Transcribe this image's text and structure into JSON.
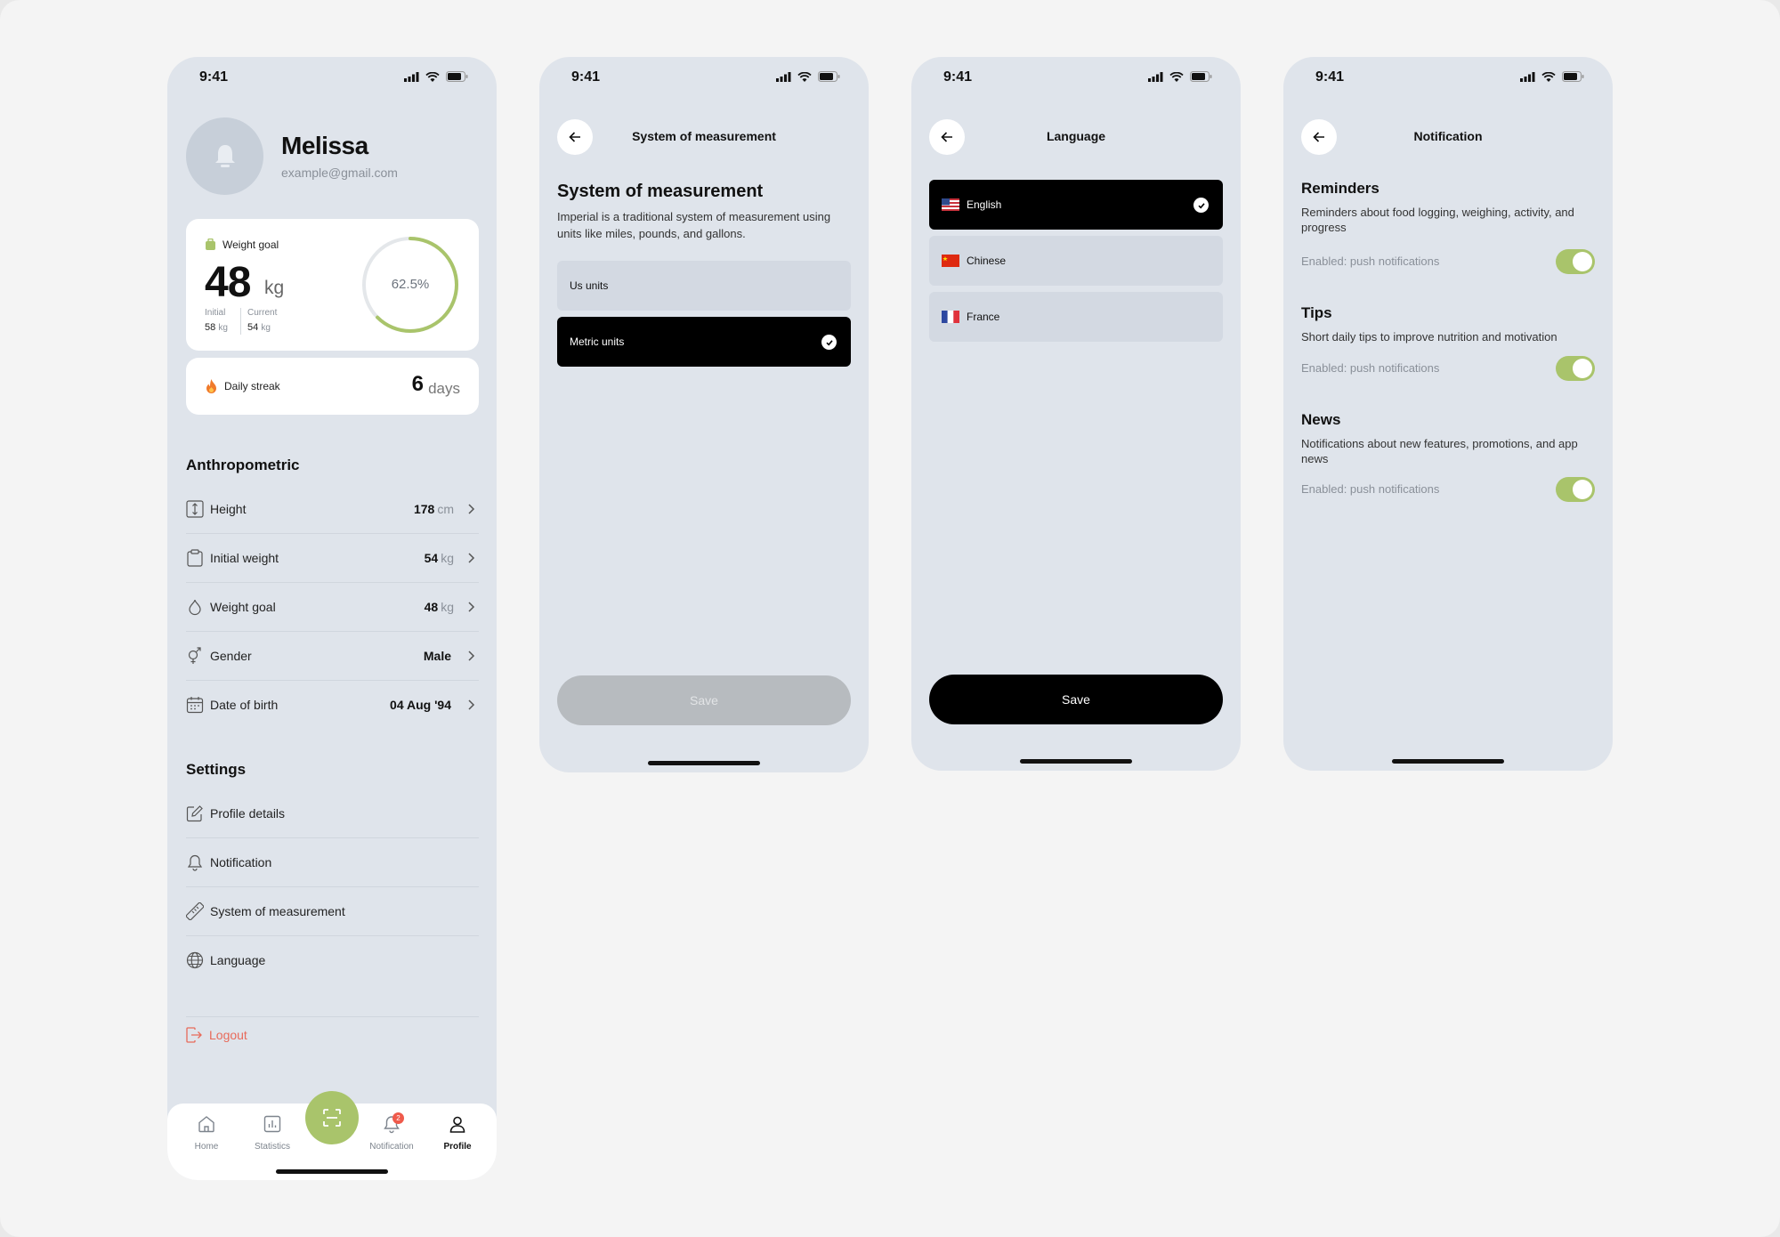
{
  "status_time": "9:41",
  "colors": {
    "accent_green": "#a9c46b",
    "danger": "#e86a5a",
    "phone_bg": "#dfe4eb"
  },
  "profile": {
    "name": "Melissa",
    "email": "example@gmail.com",
    "weight_goal": {
      "label": "Weight goal",
      "value": "48",
      "unit": "kg",
      "initial_label": "Initial",
      "initial_value": "58",
      "current_label": "Current",
      "current_value": "54",
      "small_unit": "kg",
      "progress_text": "62.5%",
      "progress_fraction": 0.625
    },
    "streak": {
      "label": "Daily streak",
      "value": "6",
      "unit": "days"
    },
    "anthropometric_title": "Anthropometric",
    "anthropometric": [
      {
        "label": "Height",
        "value": "178",
        "unit": "cm",
        "icon": "height-icon"
      },
      {
        "label": "Initial weight",
        "value": "54",
        "unit": "kg",
        "icon": "clipboard-icon"
      },
      {
        "label": "Weight goal",
        "value": "48",
        "unit": "kg",
        "icon": "drop-icon"
      },
      {
        "label": "Gender",
        "value": "Male",
        "unit": "",
        "icon": "gender-icon"
      },
      {
        "label": "Date of birth",
        "value": "04 Aug '94",
        "unit": "",
        "icon": "calendar-icon"
      }
    ],
    "settings_title": "Settings",
    "settings": [
      {
        "label": "Profile details",
        "icon": "edit-icon"
      },
      {
        "label": "Notification",
        "icon": "bell-icon"
      },
      {
        "label": "System of measurement",
        "icon": "ruler-icon"
      },
      {
        "label": "Language",
        "icon": "globe-icon"
      }
    ],
    "logout": "Logout",
    "tabs": [
      {
        "label": "Home",
        "icon": "home-icon"
      },
      {
        "label": "Statistics",
        "icon": "chart-icon"
      },
      {
        "label": "Notification",
        "icon": "bell-icon",
        "badge": "2"
      },
      {
        "label": "Profile",
        "icon": "user-icon",
        "active": true
      }
    ]
  },
  "measurement": {
    "header": "System of measurement",
    "title": "System of measurement",
    "description": "Imperial is a traditional system of measurement using units like miles, pounds, and gallons.",
    "options": [
      {
        "label": "Us units",
        "selected": false
      },
      {
        "label": "Metric units",
        "selected": true
      }
    ],
    "save": "Save"
  },
  "language": {
    "header": "Language",
    "options": [
      {
        "label": "English",
        "flag": "us-flag-icon",
        "selected": true
      },
      {
        "label": "Chinese",
        "flag": "china-flag-icon",
        "selected": false
      },
      {
        "label": "France",
        "flag": "france-flag-icon",
        "selected": false
      }
    ],
    "save": "Save"
  },
  "notification": {
    "header": "Notification",
    "sections": [
      {
        "title": "Reminders",
        "desc": "Reminders about food logging, weighing, activity, and progress",
        "status": "Enabled: push notifications",
        "enabled": true
      },
      {
        "title": "Tips",
        "desc": "Short daily tips to improve nutrition and motivation",
        "status": "Enabled: push notifications",
        "enabled": true
      },
      {
        "title": "News",
        "desc": "Notifications about new features, promotions, and app news",
        "status": "Enabled: push notifications",
        "enabled": true
      }
    ]
  }
}
